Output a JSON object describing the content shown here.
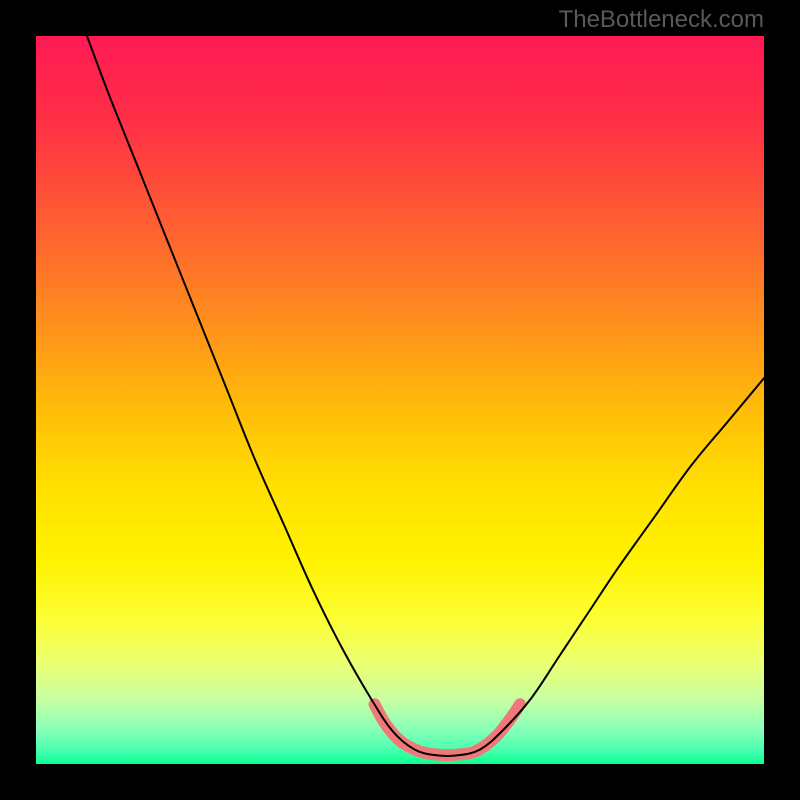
{
  "watermark": "TheBottleneck.com",
  "chart_data": {
    "type": "line",
    "title": "",
    "xlabel": "",
    "ylabel": "",
    "xlim": [
      0,
      100
    ],
    "ylim": [
      0,
      100
    ],
    "grid": false,
    "gradient_stops": [
      {
        "offset": 0.0,
        "color": "#ff1a55"
      },
      {
        "offset": 0.12,
        "color": "#ff3046"
      },
      {
        "offset": 0.25,
        "color": "#ff5c33"
      },
      {
        "offset": 0.38,
        "color": "#ff8a1f"
      },
      {
        "offset": 0.5,
        "color": "#ffb80a"
      },
      {
        "offset": 0.62,
        "color": "#ffe000"
      },
      {
        "offset": 0.72,
        "color": "#fff200"
      },
      {
        "offset": 0.8,
        "color": "#fdff33"
      },
      {
        "offset": 0.86,
        "color": "#ecff70"
      },
      {
        "offset": 0.91,
        "color": "#c9ffa0"
      },
      {
        "offset": 0.95,
        "color": "#8dffb8"
      },
      {
        "offset": 0.98,
        "color": "#4cffb0"
      },
      {
        "offset": 1.0,
        "color": "#0aff90"
      }
    ],
    "series": [
      {
        "name": "bottleneck-curve",
        "color": "#000000",
        "width": 2,
        "points": [
          {
            "x": 7.0,
            "y": 100.0
          },
          {
            "x": 10.0,
            "y": 92.0
          },
          {
            "x": 14.0,
            "y": 82.0
          },
          {
            "x": 18.0,
            "y": 72.0
          },
          {
            "x": 22.0,
            "y": 62.0
          },
          {
            "x": 26.0,
            "y": 52.0
          },
          {
            "x": 30.0,
            "y": 42.0
          },
          {
            "x": 34.0,
            "y": 33.0
          },
          {
            "x": 38.0,
            "y": 24.0
          },
          {
            "x": 42.0,
            "y": 16.0
          },
          {
            "x": 46.0,
            "y": 9.0
          },
          {
            "x": 49.0,
            "y": 4.5
          },
          {
            "x": 52.0,
            "y": 2.0
          },
          {
            "x": 55.0,
            "y": 1.2
          },
          {
            "x": 58.0,
            "y": 1.2
          },
          {
            "x": 61.0,
            "y": 2.0
          },
          {
            "x": 64.0,
            "y": 4.5
          },
          {
            "x": 68.0,
            "y": 9.0
          },
          {
            "x": 72.0,
            "y": 15.0
          },
          {
            "x": 76.0,
            "y": 21.0
          },
          {
            "x": 80.0,
            "y": 27.0
          },
          {
            "x": 85.0,
            "y": 34.0
          },
          {
            "x": 90.0,
            "y": 41.0
          },
          {
            "x": 95.0,
            "y": 47.0
          },
          {
            "x": 100.0,
            "y": 53.0
          }
        ]
      },
      {
        "name": "optimal-band",
        "color": "#f07878",
        "width": 12,
        "points": [
          {
            "x": 46.5,
            "y": 8.2
          },
          {
            "x": 48.0,
            "y": 5.5
          },
          {
            "x": 50.0,
            "y": 3.2
          },
          {
            "x": 52.5,
            "y": 1.8
          },
          {
            "x": 55.0,
            "y": 1.3
          },
          {
            "x": 58.0,
            "y": 1.3
          },
          {
            "x": 60.5,
            "y": 1.8
          },
          {
            "x": 63.0,
            "y": 3.6
          },
          {
            "x": 65.0,
            "y": 6.0
          },
          {
            "x": 66.5,
            "y": 8.2
          }
        ]
      }
    ]
  }
}
